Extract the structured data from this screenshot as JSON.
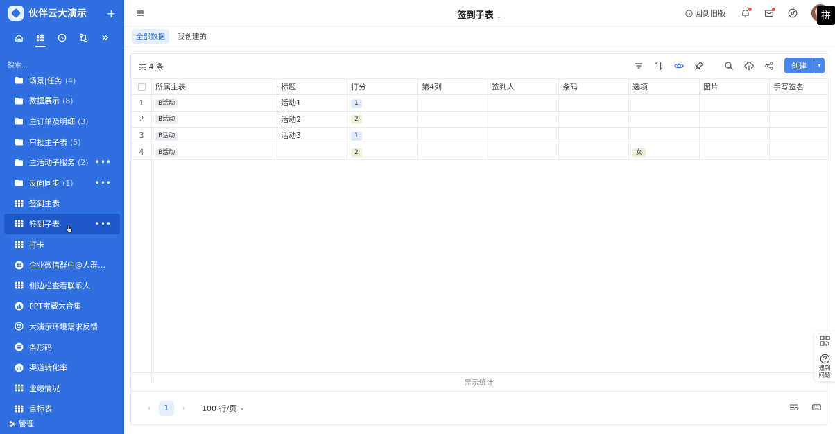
{
  "sidebar": {
    "app_name": "伙伴云大演示",
    "search_placeholder": "搜索...",
    "items": [
      {
        "label": "场景|任务",
        "count": "(4)",
        "icon": "folder-icon",
        "more": false
      },
      {
        "label": "数据展示",
        "count": "(8)",
        "icon": "folder-icon",
        "more": false
      },
      {
        "label": "主订单及明细",
        "count": "(3)",
        "icon": "folder-icon",
        "more": false
      },
      {
        "label": "审批主子表",
        "count": "(5)",
        "icon": "folder-icon",
        "more": false
      },
      {
        "label": "主活动子服务",
        "count": "(2)",
        "icon": "folder-icon",
        "more": true
      },
      {
        "label": "反向同步",
        "count": "(1)",
        "icon": "folder-icon",
        "more": true
      },
      {
        "label": "签到主表",
        "count": "",
        "icon": "table-icon",
        "more": false
      },
      {
        "label": "签到子表",
        "count": "",
        "icon": "table-icon",
        "more": true,
        "active": true
      },
      {
        "label": "打卡",
        "count": "",
        "icon": "table-icon",
        "more": false
      },
      {
        "label": "企业微信群中@人群名：演...",
        "count": "",
        "icon": "group-icon",
        "more": false
      },
      {
        "label": "侧边栏查看联系人",
        "count": "",
        "icon": "table-icon",
        "more": false
      },
      {
        "label": "PPT宝藏大合集",
        "count": "",
        "icon": "thumbs-up-icon",
        "more": false
      },
      {
        "label": "大演示环境需求反馈",
        "count": "",
        "icon": "smile-icon",
        "more": false
      },
      {
        "label": "条形码",
        "count": "",
        "icon": "card-icon",
        "more": false
      },
      {
        "label": "渠道转化率",
        "count": "",
        "icon": "bar-chart-icon",
        "more": false
      },
      {
        "label": "业绩情况",
        "count": "",
        "icon": "table-icon",
        "more": false
      },
      {
        "label": "目标表",
        "count": "",
        "icon": "table-icon",
        "more": false
      }
    ],
    "footer_label": "管理"
  },
  "topbar": {
    "title": "签到子表",
    "old_version_label": "回到旧版",
    "ime_char": "拼"
  },
  "views": {
    "tabs": [
      "全部数据",
      "我创建的"
    ]
  },
  "table": {
    "count_label": "共 4 条",
    "create_label": "创建",
    "columns": [
      "所属主表",
      "标题",
      "打分",
      "第4列",
      "签到人",
      "条码",
      "选项",
      "图片",
      "手写签名"
    ],
    "rows": [
      {
        "n": "1",
        "parent": "B活动",
        "title": "活动1",
        "score": "1",
        "option": ""
      },
      {
        "n": "2",
        "parent": "B活动",
        "title": "活动2",
        "score": "2",
        "option": ""
      },
      {
        "n": "3",
        "parent": "B活动",
        "title": "活动3",
        "score": "1",
        "option": ""
      },
      {
        "n": "4",
        "parent": "B活动",
        "title": "",
        "score": "2",
        "option": "女"
      }
    ],
    "stats_label": "显示统计",
    "page": "1",
    "per_page": "100 行/页"
  },
  "help": {
    "label": "遇到问题"
  },
  "colors": {
    "sidebar_bg": "#2f6fe0",
    "accent": "#4a85ea",
    "score_1_bg": "#dde9fb",
    "score_2_bg": "#eaf1d6"
  }
}
